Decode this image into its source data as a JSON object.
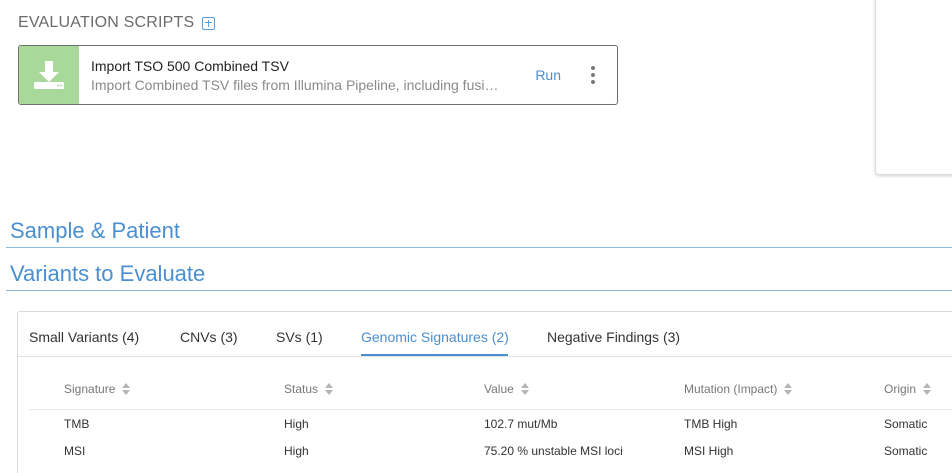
{
  "evaluation_scripts": {
    "title": "EVALUATION SCRIPTS",
    "add_icon": "plus-square-icon",
    "scripts": [
      {
        "icon": "download-icon",
        "icon_bg": "#a9d99a",
        "name": "Import TSO 500 Combined TSV",
        "description": "Import Combined TSV files from Illumina Pipeline, including fusi…",
        "run_label": "Run",
        "menu_icon": "kebab-icon"
      }
    ]
  },
  "sections": {
    "sample_patient": "Sample & Patient",
    "variants": "Variants to Evaluate"
  },
  "variants": {
    "tabs": [
      {
        "label": "Small Variants (4)",
        "active": false
      },
      {
        "label": "CNVs (3)",
        "active": false
      },
      {
        "label": "SVs (1)",
        "active": false
      },
      {
        "label": "Genomic Signatures (2)",
        "active": true
      },
      {
        "label": "Negative Findings (3)",
        "active": false
      }
    ],
    "table": {
      "columns": [
        "Signature",
        "Status",
        "Value",
        "Mutation (Impact)",
        "Origin"
      ],
      "rows": [
        [
          "TMB",
          "High",
          "102.7 mut/Mb",
          "TMB High",
          "Somatic"
        ],
        [
          "MSI",
          "High",
          "75.20 % unstable MSI loci",
          "MSI High",
          "Somatic"
        ]
      ]
    }
  },
  "colors": {
    "accent": "#4a8fd0",
    "script_icon_bg": "#a9d99a"
  }
}
